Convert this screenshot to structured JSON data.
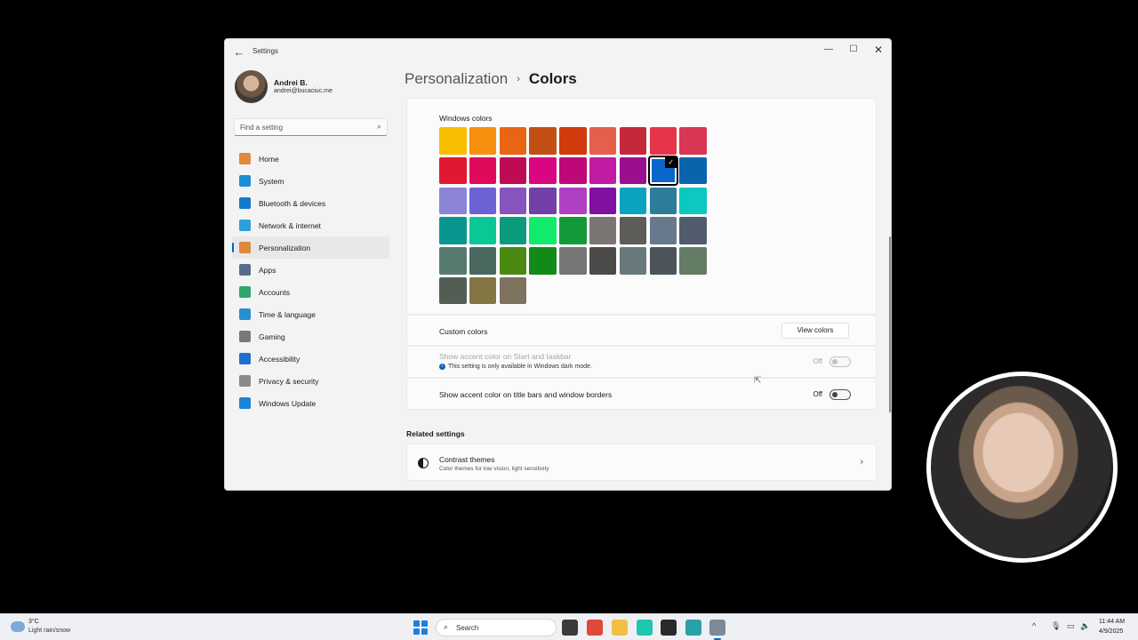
{
  "window": {
    "app_title": "Settings",
    "back_glyph": "←",
    "minimize_glyph": "—",
    "maximize_glyph": "☐",
    "close_glyph": "✕"
  },
  "profile": {
    "name": "Andrei B.",
    "email": "andrei@bucaciuc.me"
  },
  "search": {
    "placeholder": "Find a setting",
    "icon": "⌕"
  },
  "sidebar": {
    "items": [
      {
        "label": "Home",
        "icon": "home-icon",
        "color": "#e08a3c"
      },
      {
        "label": "System",
        "icon": "system-icon",
        "color": "#1b8fd1"
      },
      {
        "label": "Bluetooth & devices",
        "icon": "bluetooth-icon",
        "color": "#1478cc"
      },
      {
        "label": "Network & internet",
        "icon": "network-icon",
        "color": "#2ea0d8"
      },
      {
        "label": "Personalization",
        "icon": "brush-icon",
        "color": "#d98a3c",
        "active": true
      },
      {
        "label": "Apps",
        "icon": "apps-icon",
        "color": "#5a6b8c"
      },
      {
        "label": "Accounts",
        "icon": "accounts-icon",
        "color": "#2fa86a"
      },
      {
        "label": "Time & language",
        "icon": "globe-icon",
        "color": "#2a8fd0"
      },
      {
        "label": "Gaming",
        "icon": "gaming-icon",
        "color": "#7a7a7a"
      },
      {
        "label": "Accessibility",
        "icon": "accessibility-icon",
        "color": "#1f6fd0"
      },
      {
        "label": "Privacy & security",
        "icon": "shield-icon",
        "color": "#8a8a8a"
      },
      {
        "label": "Windows Update",
        "icon": "update-icon",
        "color": "#1a84d8"
      }
    ]
  },
  "breadcrumb": {
    "parent": "Personalization",
    "separator": "›",
    "current": "Colors"
  },
  "windows_colors": {
    "label": "Windows colors",
    "selected_index": 16,
    "check_glyph": "✓",
    "swatches": [
      "#f7bf00",
      "#f7900f",
      "#ea6513",
      "#c34f14",
      "#d03a0c",
      "#e4604d",
      "#c4283a",
      "#e6344a",
      "#d93653",
      "#e11930",
      "#e00a5a",
      "#bf0a56",
      "#d90583",
      "#be0778",
      "#c21ba3",
      "#9a0f8e",
      "#0a66c8",
      "#0a64ad",
      "#8c84d6",
      "#6c62d6",
      "#8854c0",
      "#7440a8",
      "#b040c3",
      "#8010a0",
      "#0aa3c0",
      "#2d7d9a",
      "#0bc8c0",
      "#0a9690",
      "#0ac896",
      "#0a9a7c",
      "#10eb6c",
      "#129a3a",
      "#7a7674",
      "#5e5c58",
      "#69798c",
      "#515c6c",
      "#567c72",
      "#486860",
      "#4a8a12",
      "#128a18",
      "#767676",
      "#4c4a48",
      "#69797e",
      "#4a5459",
      "#647c64",
      "#525e54",
      "#847545",
      "#7e735f"
    ]
  },
  "custom_colors": {
    "label": "Custom colors",
    "button": "View colors"
  },
  "accent_start": {
    "label": "Show accent color on Start and taskbar",
    "note": "This setting is only available in Windows dark mode.",
    "info_glyph": "i",
    "state": "Off"
  },
  "accent_title": {
    "label": "Show accent color on title bars and window borders",
    "state": "Off"
  },
  "related": {
    "heading": "Related settings",
    "items": [
      {
        "title": "Contrast themes",
        "subtitle": "Color themes for low vision, light sensitivity",
        "chevron": "›"
      }
    ]
  },
  "taskbar": {
    "weather_temp": "3°C",
    "weather_condition": "Light rain/snow",
    "search_placeholder": "Search",
    "search_icon": "⌕",
    "apps": [
      {
        "icon": "task-view-icon",
        "color": "#3a3a3a"
      },
      {
        "icon": "chrome-icon",
        "color": "#e0483a"
      },
      {
        "icon": "file-explorer-icon",
        "color": "#f0c040"
      },
      {
        "icon": "chatgpt-icon",
        "color": "#1ec6b0"
      },
      {
        "icon": "obs-icon",
        "color": "#2a2a2a"
      },
      {
        "icon": "notepad-icon",
        "color": "#2aa0a8"
      },
      {
        "icon": "settings-icon",
        "color": "#7a8a9a",
        "active": true
      }
    ],
    "tray_chevron": "^",
    "time": "11:44 AM",
    "date": "4/9/2025"
  }
}
